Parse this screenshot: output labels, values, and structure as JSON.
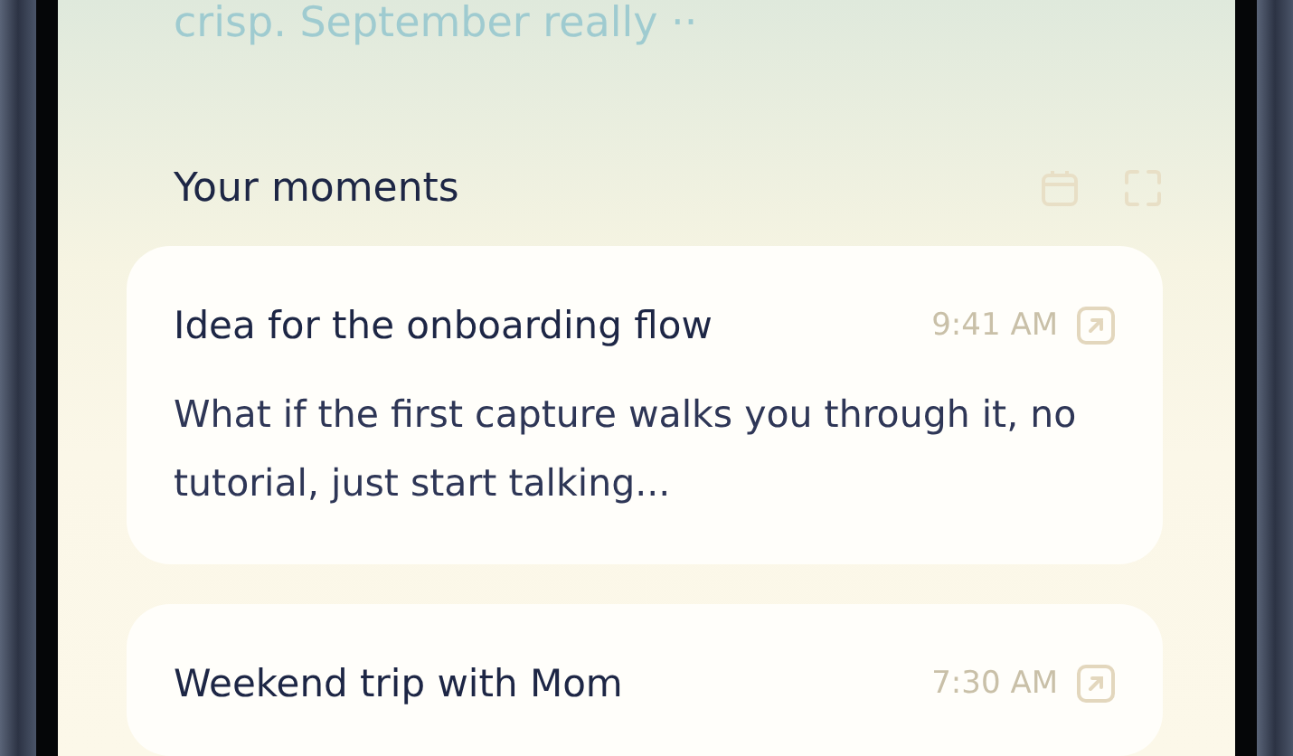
{
  "intro_text": "crisp. September really ··",
  "section": {
    "title": "Your moments"
  },
  "moments": [
    {
      "title": "Idea for the onboarding flow",
      "time": "9:41 AM",
      "body": "What if the first capture walks you through it, no tutorial, just start talking..."
    },
    {
      "title": "Weekend trip with Mom",
      "time": "7:30 AM"
    }
  ]
}
